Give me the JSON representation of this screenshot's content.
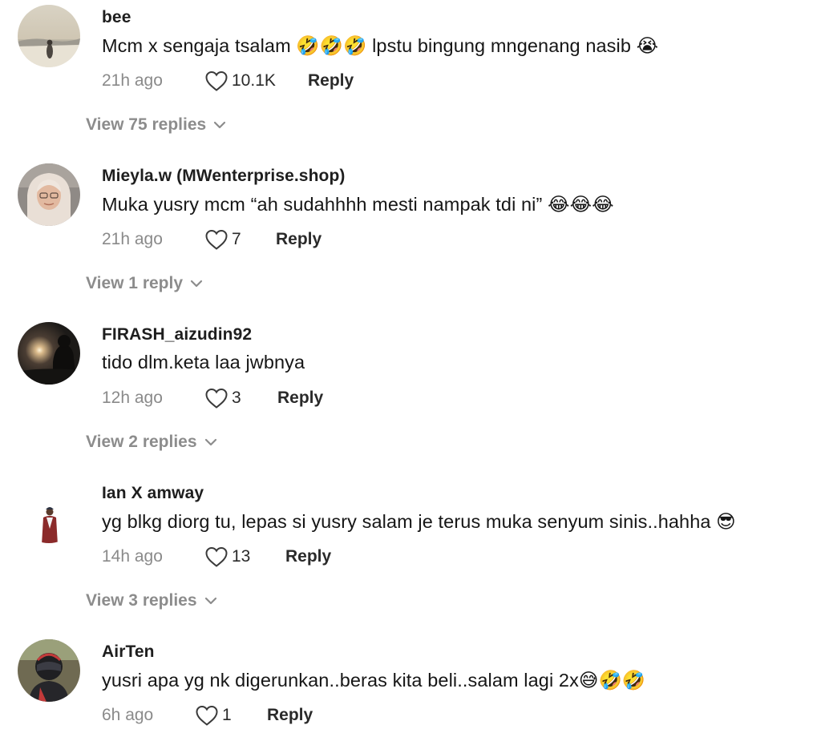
{
  "comments": [
    {
      "username": "bee",
      "text": "Mcm x sengaja tsalam 🤣🤣🤣 lpstu bingung mngenang nasib 😭",
      "time": "21h ago",
      "likes": "10.1K",
      "reply_label": "Reply",
      "view_replies": "View 75 replies"
    },
    {
      "username": "Mieyla.w (MWenterprise.shop)",
      "text": "Muka yusry mcm “ah sudahhhh mesti nampak tdi ni” 😂😂😂",
      "time": "21h ago",
      "likes": "7",
      "reply_label": "Reply",
      "view_replies": "View 1 reply"
    },
    {
      "username": "FIRASH_aizudin92",
      "text": "tido dlm.keta laa jwbnya",
      "time": "12h ago",
      "likes": "3",
      "reply_label": "Reply",
      "view_replies": "View 2 replies"
    },
    {
      "username": "Ian X amway",
      "text": "yg blkg diorg tu, lepas si yusry salam je terus muka senyum sinis..hahha 😎",
      "time": "14h ago",
      "likes": "13",
      "reply_label": "Reply",
      "view_replies": "View 3 replies"
    },
    {
      "username": "AirTen",
      "text": "yusri apa yg nk digerunkan..beras kita beli..salam lagi 2x😅🤣🤣",
      "time": "6h ago",
      "likes": "1",
      "reply_label": "Reply"
    }
  ],
  "icons": {
    "like": "heart-outline-icon",
    "expand": "chevron-down-icon"
  },
  "colors": {
    "username": "#1e1e1e",
    "comment_text": "#161616",
    "timestamp": "#8a8a8a",
    "view_replies": "#8c8c8c",
    "heart_outline": "#3a3a3a"
  }
}
